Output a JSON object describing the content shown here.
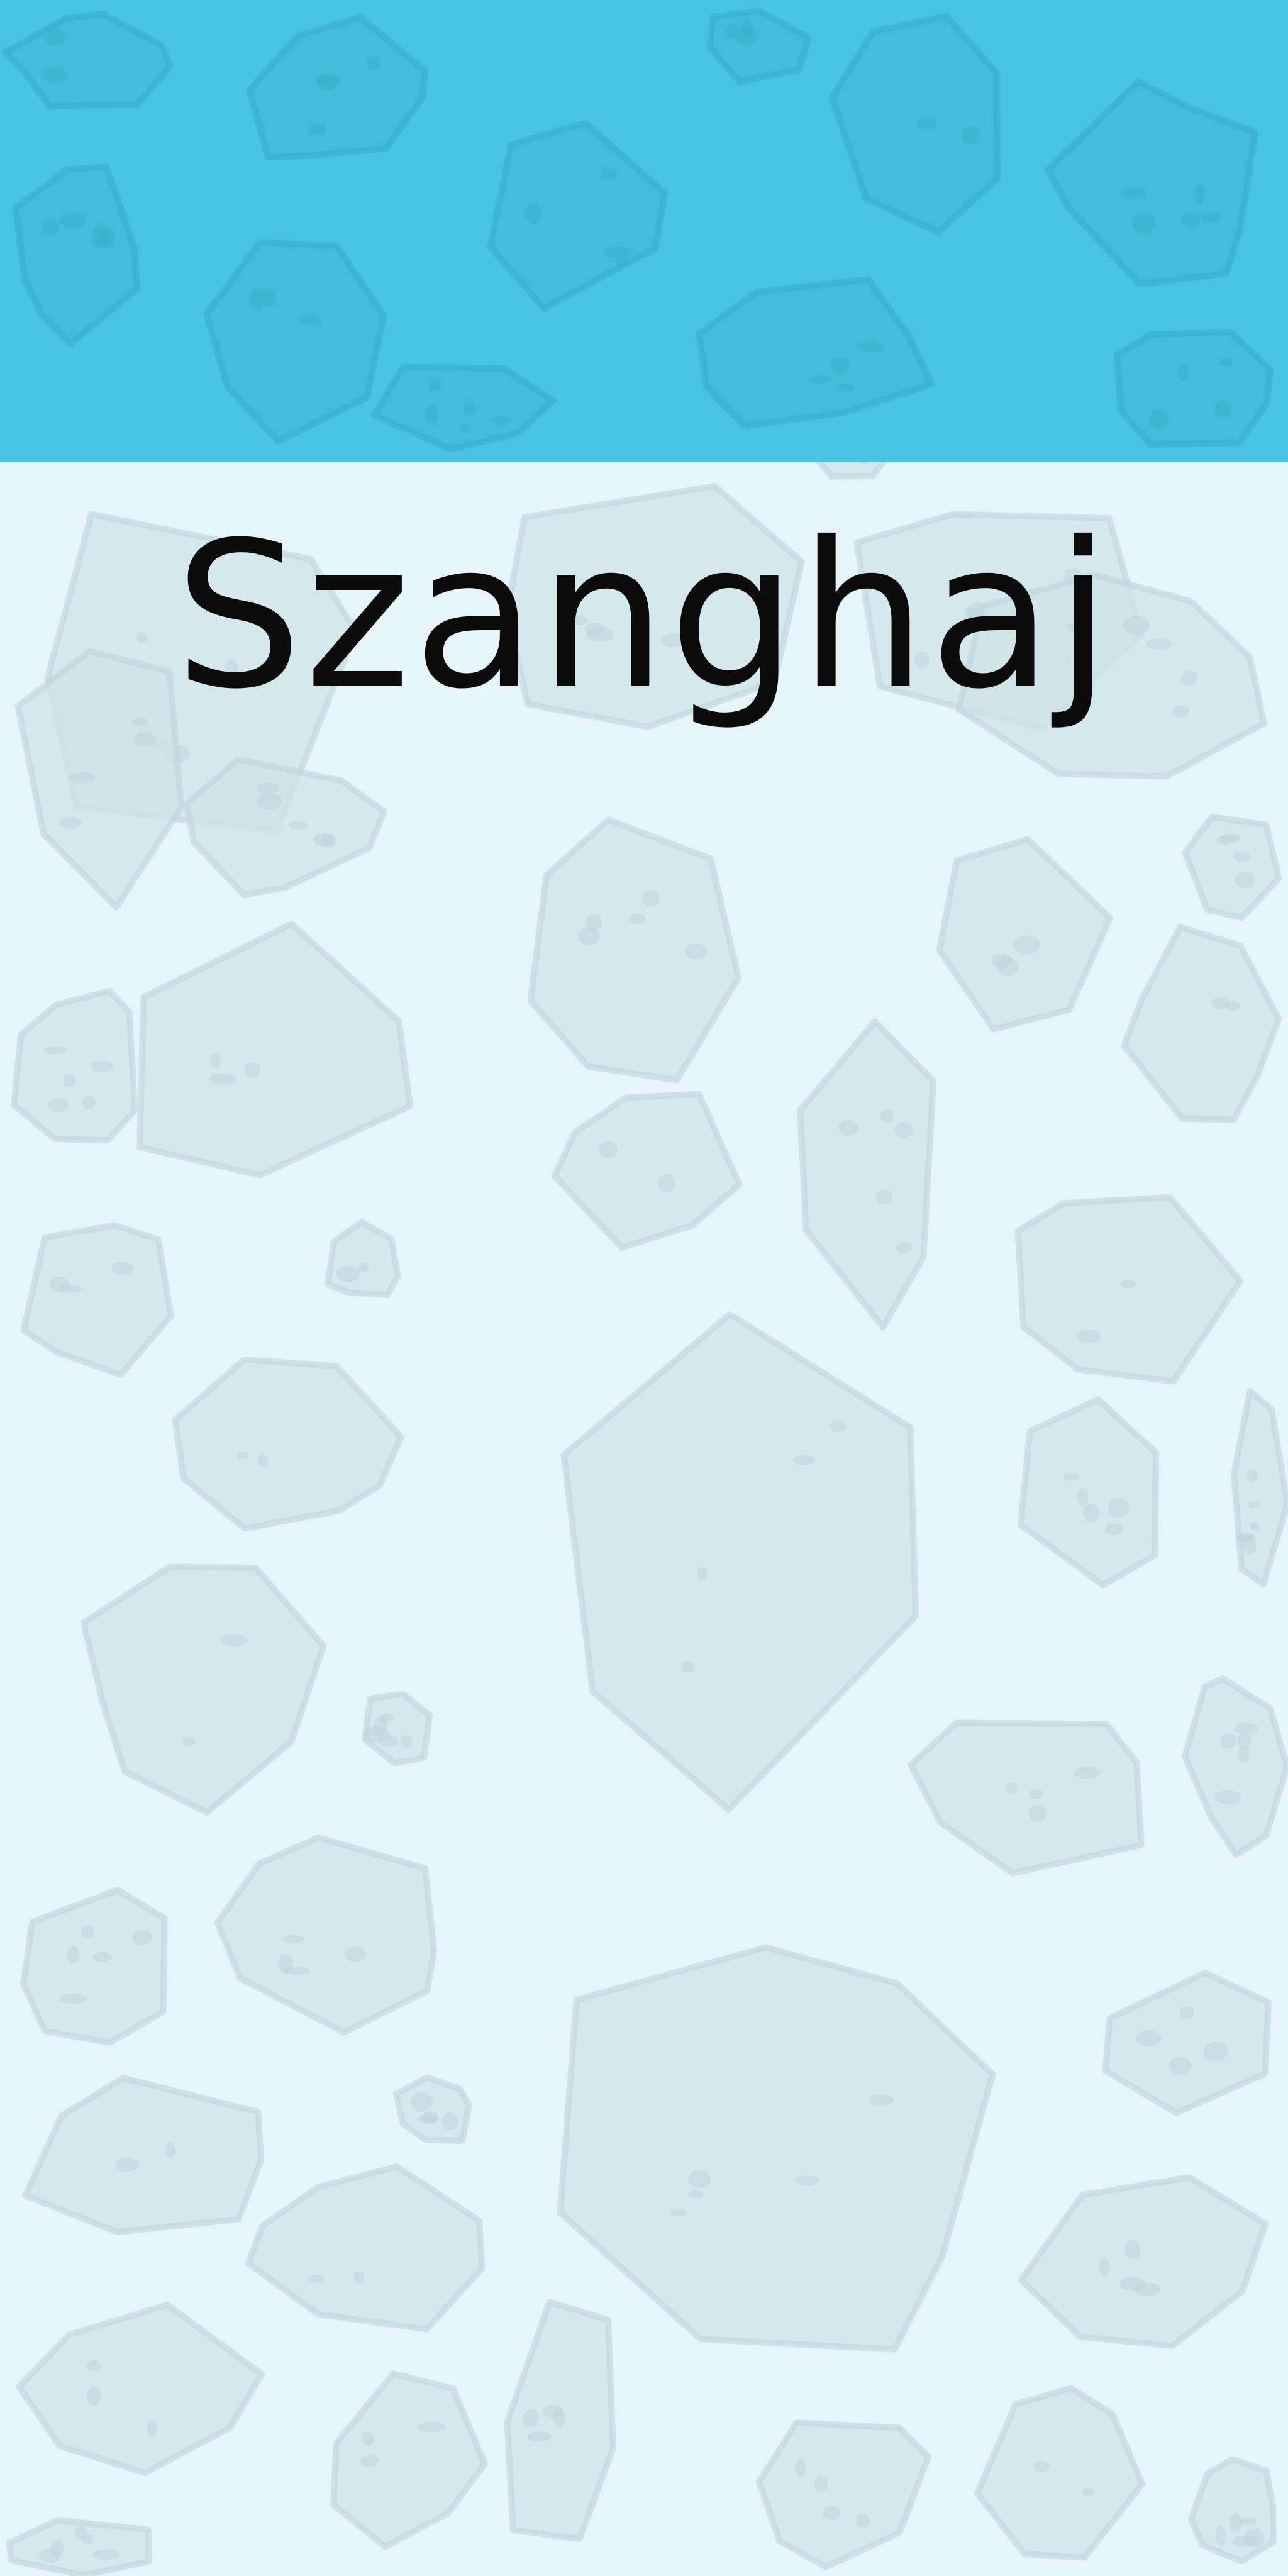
{
  "title": "Szanghaj",
  "colors": {
    "header": "#48c3e1",
    "background": "#e5f5fb",
    "title_text": "#0b0b0b",
    "stone_fill": "#cfe3e8",
    "stone_edge": "#bcd6dc"
  },
  "decoration": {
    "background_pattern": "stone-texture"
  }
}
